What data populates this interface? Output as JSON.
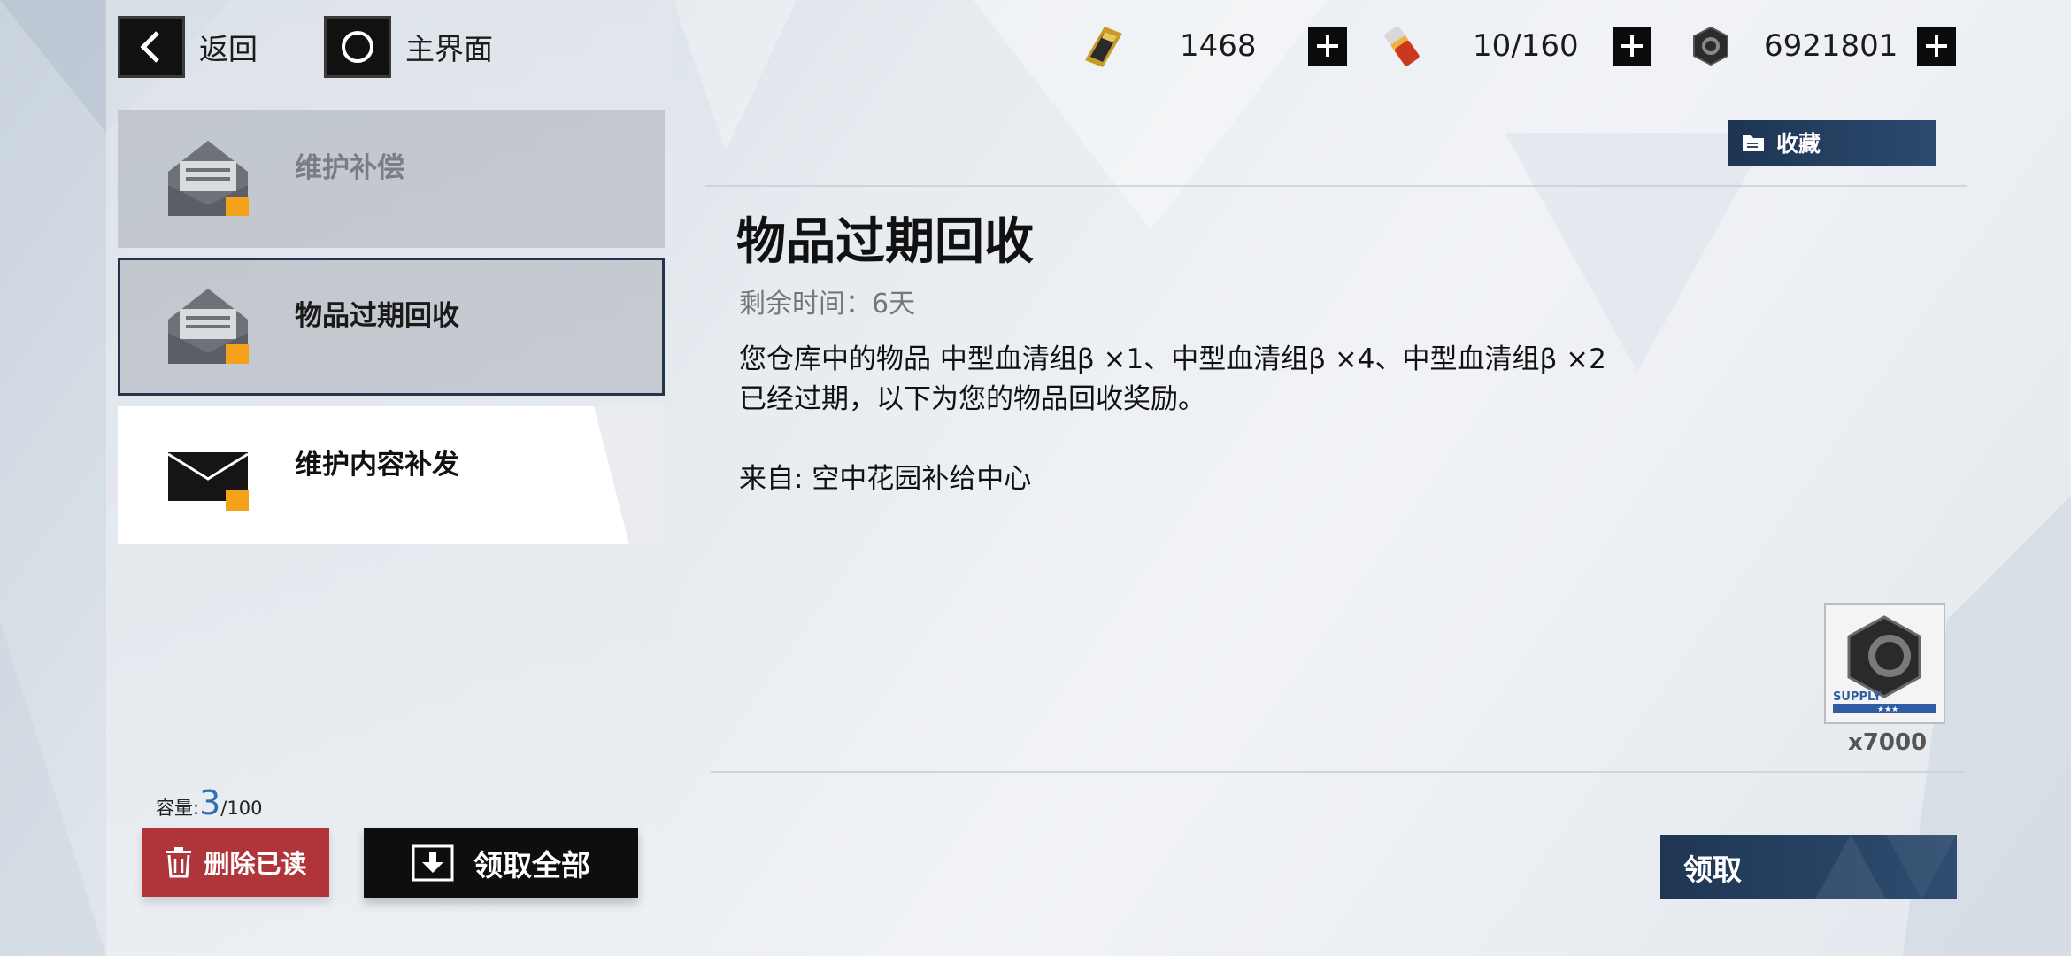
{
  "nav": {
    "back_label": "返回",
    "home_label": "主界面"
  },
  "resources": [
    {
      "icon": "gold-bar-icon",
      "value": "1468"
    },
    {
      "icon": "battery-cell-icon",
      "value": "10/160"
    },
    {
      "icon": "hex-nut-icon",
      "value": "6921801"
    }
  ],
  "mail_list": [
    {
      "title": "维护补偿",
      "state": "read"
    },
    {
      "title": "物品过期回收",
      "state": "selected"
    },
    {
      "title": "维护内容补发",
      "state": "unread"
    }
  ],
  "capacity": {
    "label": "容量:",
    "used": "3",
    "max": "/100"
  },
  "buttons": {
    "delete_read": "删除已读",
    "claim_all": "领取全部",
    "favorite": "收藏",
    "claim": "领取"
  },
  "mail": {
    "title": "物品过期回收",
    "remaining": "剩余时间：6天",
    "body_line1": "您仓库中的物品 中型血清组β ×1、中型血清组β ×4、中型血清组β ×2",
    "body_line2": "已经过期，以下为您的物品回收奖励。",
    "from": "来自: 空中花园补给中心",
    "reward": {
      "icon": "hex-nut-icon",
      "tag": "SUPPLY",
      "count": "x7000"
    }
  },
  "colors": {
    "accent_blue": "#2c4a6e",
    "delete_red": "#b0353a",
    "capacity_blue": "#2f6fb5",
    "badge_orange": "#f5a21b"
  }
}
